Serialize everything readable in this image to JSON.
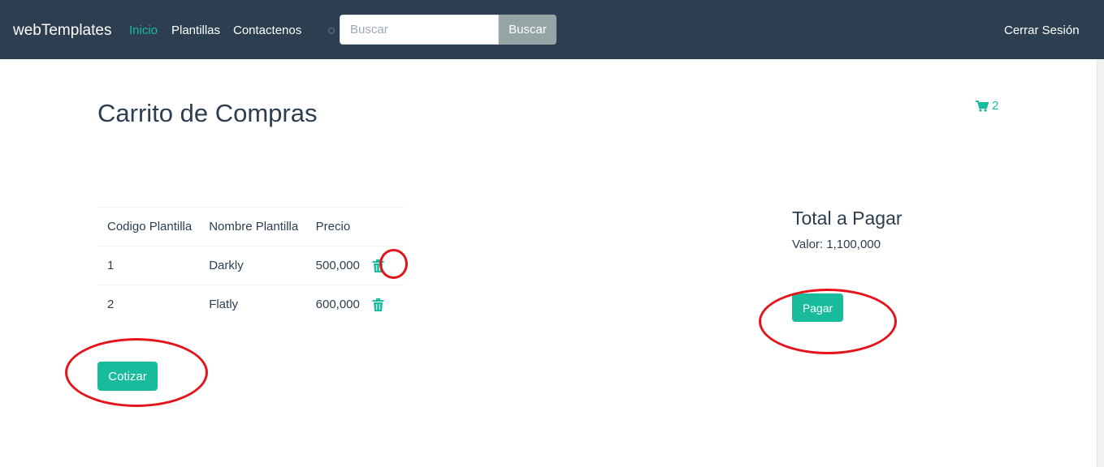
{
  "navbar": {
    "brand": "webTemplates",
    "links": [
      "Inicio",
      "Plantillas",
      "Contactenos"
    ],
    "active_link": "Inicio",
    "search": {
      "placeholder": "Buscar",
      "button_label": "Buscar"
    },
    "logout_label": "Cerrar Sesión"
  },
  "page": {
    "title": "Carrito de Compras",
    "cart_icon": "shopping-cart-icon",
    "cart_count": "2"
  },
  "table": {
    "headers": [
      "Codigo Plantilla",
      "Nombre Plantilla",
      "Precio"
    ],
    "rows": [
      {
        "code": "1",
        "name": "Darkly",
        "price": "500,000",
        "delete_icon": "trash-icon"
      },
      {
        "code": "2",
        "name": "Flatly",
        "price": "600,000",
        "delete_icon": "trash-icon"
      }
    ]
  },
  "actions": {
    "quote_label": "Cotizar",
    "pay_label": "Pagar"
  },
  "summary": {
    "heading": "Total a Pagar",
    "value_text": "Valor: 1,100,000"
  },
  "colors": {
    "navbar_bg": "#2c3e50",
    "accent": "#18bc9c",
    "secondary_button": "#95a5a6",
    "annotation": "#e3141b"
  }
}
